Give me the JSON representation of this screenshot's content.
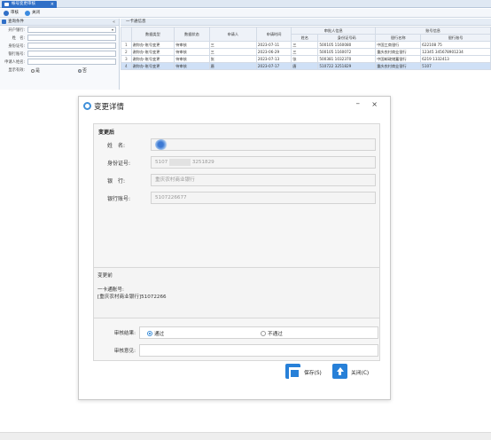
{
  "tab": {
    "label": "帐号变更审核",
    "close": "×"
  },
  "toolbar": {
    "audit_label": "审核",
    "close_label": "关闭"
  },
  "query_panel": {
    "title": "查询条件",
    "pin": "«",
    "fields": [
      {
        "label": "开户银行:",
        "value": "",
        "dropdown": true
      },
      {
        "label": "姓　名:",
        "value": ""
      },
      {
        "label": "身份证号:",
        "value": ""
      },
      {
        "label": "银行账号:",
        "value": ""
      },
      {
        "label": "申请人姓名:",
        "value": ""
      }
    ],
    "display": {
      "label": "显示有效:",
      "option_yes": "是",
      "option_no": "否"
    }
  },
  "grid": {
    "title": "一卡通信息",
    "headers_top": [
      "",
      "数据类型",
      "数据状态",
      "申请人",
      "申请时间",
      "审批人信息",
      "账号信息"
    ],
    "headers_sub": [
      "姓名",
      "身份证号码",
      "银行名称",
      "银行账号"
    ],
    "rows": [
      {
        "num": "1",
        "type": "谢你办-账号变更",
        "status": "待审核",
        "applicant": "三",
        "time": "2023-07-11",
        "name": "三",
        "id": "500105 1160080",
        "bank": "中国工商银行",
        "account": "622108 75"
      },
      {
        "num": "2",
        "type": "谢你办-账号变更",
        "status": "待审核",
        "applicant": "三",
        "time": "2023-06-29",
        "name": "三",
        "id": "500105 1160072",
        "bank": "重庆农村商业银行",
        "account": "12345 345678901234"
      },
      {
        "num": "3",
        "type": "谢你办-账号变更",
        "status": "待审核",
        "applicant": "张",
        "time": "2023-07-13",
        "name": "张",
        "id": "500381 1032370",
        "bank": "中国邮政储蓄银行",
        "account": "6219 1332413"
      },
      {
        "num": "4",
        "type": "谢你办-账号变更",
        "status": "待审核",
        "applicant": "唐",
        "time": "2023-07-17",
        "name": "唐",
        "id": "510722 3251829",
        "bank": "重庆农村商业银行",
        "account": "5107"
      }
    ]
  },
  "dialog": {
    "title": "变更详情",
    "minimize": "–",
    "close": "×",
    "after_title": "变更后",
    "fields": {
      "name_label": "姓　名:",
      "name_value": "",
      "id_label": "身份证号:",
      "id_prefix": "5107",
      "id_suffix": "3251829",
      "bank_label": "银　行:",
      "bank_value": "重庆农村商业银行",
      "account_label": "银行账号:",
      "account_value": "5107226677"
    },
    "before_title": "变更前",
    "before_line1": "一卡通账号:",
    "before_line2": "[重庆农村商业银行]51072266",
    "audit_result_label": "审核结果:",
    "audit_pass": "通过",
    "audit_fail": "不通过",
    "audit_opinion_label": "审核意见:",
    "save_label": "保存(S)",
    "close_label": "关闭(C)"
  }
}
